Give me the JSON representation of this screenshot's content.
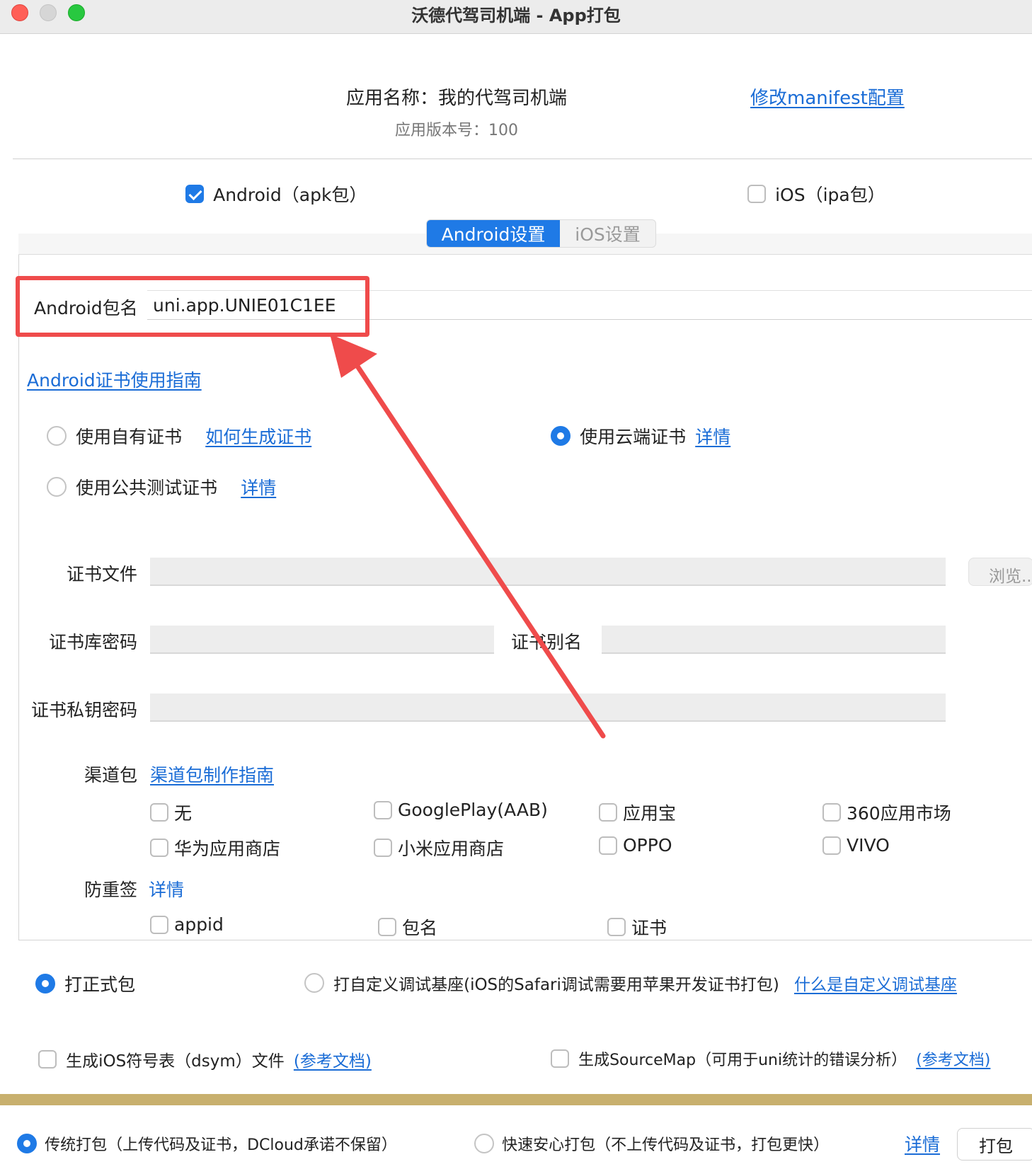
{
  "window": {
    "title": "沃德代驾司机端 - App打包"
  },
  "app": {
    "name_line": "应用名称：我的代驾司机端",
    "version_line": "应用版本号：100",
    "manifest_link": "修改manifest配置"
  },
  "platforms": {
    "android": {
      "label": "Android（apk包）",
      "checked": true
    },
    "ios": {
      "label": "iOS（ipa包）",
      "checked": false
    }
  },
  "tabs": [
    {
      "label": "Android设置",
      "active": true
    },
    {
      "label": "iOS设置",
      "active": false
    }
  ],
  "android": {
    "package_label": "Android包名",
    "package_value": "uni.app.UNIE01C1EE",
    "cert_guide_link": "Android证书使用指南",
    "cert_options": {
      "own": {
        "label": "使用自有证书",
        "link": "如何生成证书",
        "selected": false
      },
      "cloud": {
        "label": "使用云端证书",
        "link": "详情",
        "selected": true
      },
      "public_test": {
        "label": "使用公共测试证书",
        "link": "详情",
        "selected": false
      }
    },
    "cert_file_label": "证书文件",
    "browse_label": "浏览...",
    "keystore_password_label": "证书库密码",
    "alias_label": "证书别名",
    "key_password_label": "证书私钥密码",
    "channel_label": "渠道包",
    "channel_link": "渠道包制作指南",
    "channels": [
      "无",
      "GooglePlay(AAB)",
      "应用宝",
      "360应用市场",
      "华为应用商店",
      "小米应用商店",
      "OPPO",
      "VIVO"
    ],
    "anti_resign_label": "防重签",
    "anti_resign_link": "详情",
    "anti_resign_options": [
      "appid",
      "包名",
      "证书"
    ]
  },
  "build": {
    "release": {
      "label": "打正式包",
      "selected": true
    },
    "custom_base": {
      "label": "打自定义调试基座(iOS的Safari调试需要用苹果开发证书打包)",
      "selected": false
    },
    "custom_base_link": "什么是自定义调试基座",
    "dsym": {
      "label": "生成iOS符号表（dsym）文件",
      "link": "(参考文档)",
      "checked": false
    },
    "sourcemap": {
      "label": "生成SourceMap（可用于uni统计的错误分析）",
      "link": "(参考文档)",
      "checked": false
    }
  },
  "footer": {
    "traditional": {
      "label": "传统打包（上传代码及证书，DCloud承诺不保留）",
      "selected": true
    },
    "fast": {
      "label": "快速安心打包（不上传代码及证书，打包更快）",
      "selected": false
    },
    "details_link": "详情",
    "pack_button": "打包"
  },
  "colors": {
    "accent": "#1f7ae6",
    "highlight": "#ef4b4b",
    "gold_bar": "#c8b06e"
  },
  "annotation": {
    "type": "red-arrow",
    "points_to": "package-name-field"
  }
}
